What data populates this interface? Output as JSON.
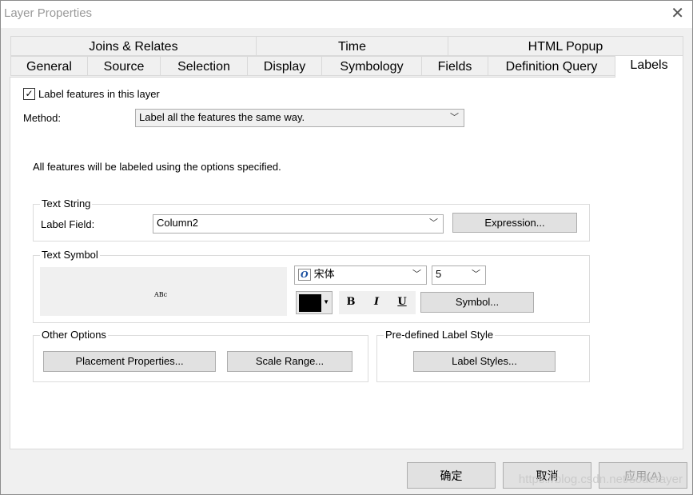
{
  "window": {
    "title": "Layer Properties"
  },
  "tabs_row1": [
    {
      "label": "Joins & Relates"
    },
    {
      "label": "Time"
    },
    {
      "label": "HTML Popup"
    }
  ],
  "tabs_row2": [
    {
      "label": "General"
    },
    {
      "label": "Source"
    },
    {
      "label": "Selection"
    },
    {
      "label": "Display"
    },
    {
      "label": "Symbology"
    },
    {
      "label": "Fields"
    },
    {
      "label": "Definition Query"
    },
    {
      "label": "Labels",
      "active": true
    }
  ],
  "labels": {
    "label_features_checkbox": "Label features in this layer",
    "checkbox_checked": true,
    "method_label": "Method:",
    "method_value": "Label all the features the same way.",
    "info_text": "All features will be labeled using the options specified.",
    "text_string": {
      "title": "Text String",
      "label_field_label": "Label Field:",
      "label_field_value": "Column2",
      "expression_button": "Expression..."
    },
    "text_symbol": {
      "title": "Text Symbol",
      "preview_text": "ABc",
      "font_value": "宋体",
      "size_value": "5",
      "color": "#000000",
      "bold": "B",
      "italic": "I",
      "underline": "U",
      "symbol_button": "Symbol..."
    },
    "other_options": {
      "title": "Other Options",
      "placement_button": "Placement Properties...",
      "scale_button": "Scale Range..."
    },
    "predefined": {
      "title": "Pre-defined Label Style",
      "label_styles_button": "Label Styles..."
    }
  },
  "bottom_buttons": {
    "ok": "确定",
    "cancel": "取消",
    "apply": "应用(A)"
  },
  "watermark": "https://blog.csdn.net/soderayer"
}
